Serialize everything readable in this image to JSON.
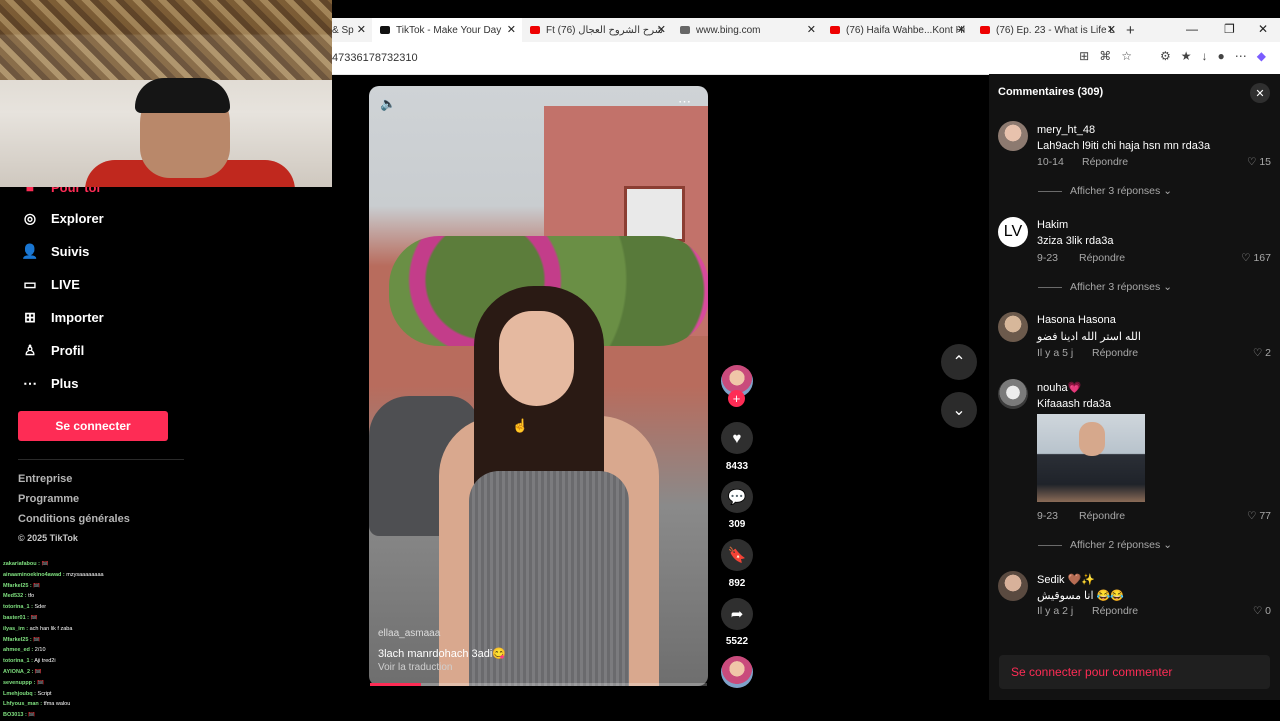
{
  "browser": {
    "tabs": [
      {
        "label": "& Sp",
        "color": "#888"
      },
      {
        "label": "TikTok - Make Your Day",
        "color": "#000"
      },
      {
        "label": "Ft شرح الشروح العجال (76)",
        "color": "#e00"
      },
      {
        "label": "www.bing.com",
        "color": "#444"
      },
      {
        "label": "(76) Haifa Wahbe...Kont Hi",
        "color": "#e00"
      },
      {
        "label": "(76) Ep. 23 - What is Life L",
        "color": "#e00"
      }
    ],
    "url": "47336178732310"
  },
  "sidebar": {
    "partial_item": "Pour toi",
    "items": [
      {
        "label": "Explorer",
        "icon": "compass-icon"
      },
      {
        "label": "Suivis",
        "icon": "user-follow-icon"
      },
      {
        "label": "LIVE",
        "icon": "live-tv-icon"
      },
      {
        "label": "Importer",
        "icon": "upload-plus-icon"
      },
      {
        "label": "Profil",
        "icon": "profile-icon"
      },
      {
        "label": "Plus",
        "icon": "more-dots-icon"
      }
    ],
    "login_button": "Se connecter",
    "footer_links": [
      "Entreprise",
      "Programme",
      "Conditions générales"
    ],
    "copyright": "© 2025 TikTok"
  },
  "chat": [
    {
      "user": "zakariafabou :",
      "msg": "🥅"
    },
    {
      "user": "ainaaminoekino4awad :",
      "msg": "mzysaaaaaaaa"
    },
    {
      "user": "Mfarkel25 :",
      "msg": "🥅"
    },
    {
      "user": "Med532 :",
      "msg": "tfo"
    },
    {
      "user": "totorina_1 :",
      "msg": "Sder"
    },
    {
      "user": "baster01 :",
      "msg": "🥅"
    },
    {
      "user": "ilyas_im :",
      "msg": "ach han lik f zaba"
    },
    {
      "user": "Mfarkel25 :",
      "msg": "🥅"
    },
    {
      "user": "ahmee_ed :",
      "msg": "2/10"
    },
    {
      "user": "totorina_1 :",
      "msg": "Aji tred2i"
    },
    {
      "user": "AYIONA_2 :",
      "msg": "🥅"
    },
    {
      "user": "sevenuppp :",
      "msg": "🥅"
    },
    {
      "user": "Lmehjoubq :",
      "msg": "Script"
    },
    {
      "user": "Lhfyous_man :",
      "msg": "tfma walou"
    },
    {
      "user": "BO3013 :",
      "msg": "🥅"
    }
  ],
  "video": {
    "username": "ellaa_asmaaa",
    "caption": "3lach manrdohach 3adi😋",
    "translate": "Voir la traduction",
    "progress": 0.15
  },
  "actions": {
    "likes": "8433",
    "comments": "309",
    "saves": "892",
    "shares": "5522"
  },
  "comments_panel": {
    "title": "Commentaires (309)",
    "reply_label": "Répondre",
    "comments": [
      {
        "user": "mery_ht_48",
        "text": "Lah9ach l9iti chi haja hsn mn rda3a",
        "date": "10-14",
        "likes": "15",
        "more": "Afficher 3 réponses"
      },
      {
        "user": "Hakim",
        "text": "3ziza 3lik rda3a",
        "date": "9-23",
        "likes": "167",
        "more": "Afficher 3 réponses"
      },
      {
        "user": "Hasona Hasona",
        "text": "الله استر الله ادينا فضو",
        "date": "Il y a 5 j",
        "likes": "2"
      },
      {
        "user": "nouha💗",
        "text": "Kifaaash rda3a",
        "date": "9-23",
        "likes": "77",
        "more": "Afficher 2 réponses"
      },
      {
        "user": "Sedik 🤎✨",
        "text": "انا مسوقيش 😂😂",
        "date": "Il y a 2 j",
        "likes": "0"
      }
    ],
    "login_to_comment": "Se connecter pour commenter"
  }
}
